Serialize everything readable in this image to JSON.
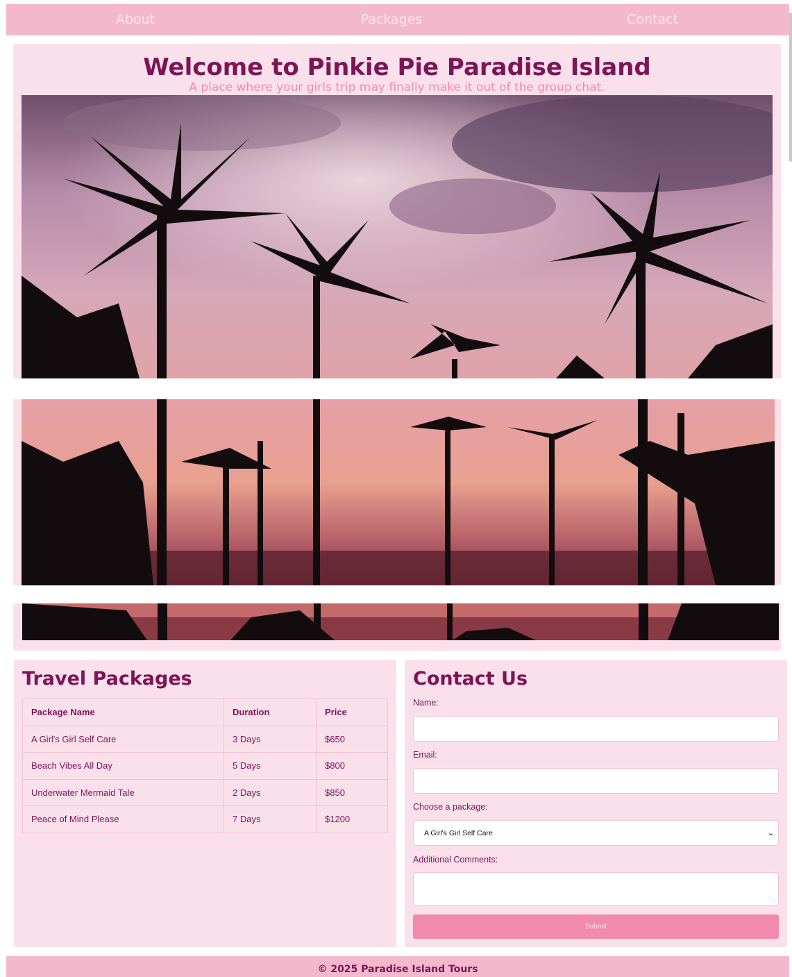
{
  "nav": {
    "items": [
      {
        "label": "About"
      },
      {
        "label": "Packages"
      },
      {
        "label": "Contact"
      }
    ]
  },
  "hero": {
    "title": "Welcome to Pinkie Pie Paradise Island",
    "tagline": "A place where your girls trip may finally make it out of the group chat."
  },
  "packages": {
    "title": "Travel Packages",
    "columns": [
      "Package Name",
      "Duration",
      "Price"
    ],
    "rows": [
      [
        "A Girl's Girl Self Care",
        "3 Days",
        "$650"
      ],
      [
        "Beach Vibes All Day",
        "5 Days",
        "$800"
      ],
      [
        "Underwater Mermaid Tale",
        "2 Days",
        "$850"
      ],
      [
        "Peace of Mind Please",
        "7 Days",
        "$1200"
      ]
    ]
  },
  "contact": {
    "title": "Contact Us",
    "name_label": "Name:",
    "name_value": "",
    "email_label": "Email:",
    "email_value": "",
    "package_label": "Choose a package:",
    "package_selected": "A Girl's Girl Self Care",
    "comments_label": "Additional Comments:",
    "comments_value": "",
    "submit_label": "Submit"
  },
  "footer": {
    "text": "© 2025 Paradise Island Tours"
  },
  "colors": {
    "nav_bg": "#f4b8cc",
    "card_bg": "#fae0ea",
    "heading": "#7d1456",
    "tagline": "#f08cb0",
    "button": "#f28aad"
  },
  "icons": {
    "select_arrow": "chevron-down-icon",
    "textarea_resize": "resize-grip-icon"
  }
}
